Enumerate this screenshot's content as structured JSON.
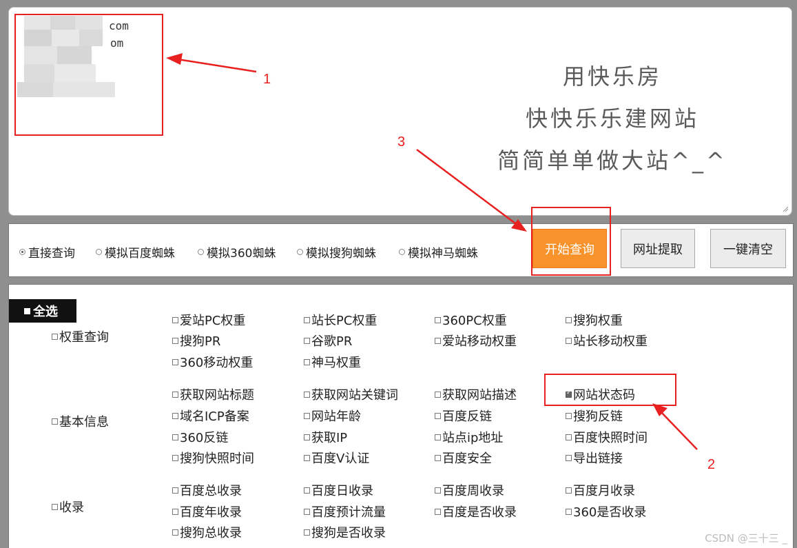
{
  "url_box": {
    "visible_lines": [
      "com",
      "om"
    ],
    "slogan": [
      "用快乐房",
      "快快乐乐建网站",
      "简简单单做大站^_^"
    ]
  },
  "query_modes": [
    {
      "label": "直接查询",
      "selected": true
    },
    {
      "label": "模拟百度蜘蛛",
      "selected": false
    },
    {
      "label": "模拟360蜘蛛",
      "selected": false
    },
    {
      "label": "模拟搜狗蜘蛛",
      "selected": false
    },
    {
      "label": "模拟神马蜘蛛",
      "selected": false
    }
  ],
  "buttons": {
    "start": "开始查询",
    "extract": "网址提取",
    "clear": "一键清空"
  },
  "panel": {
    "select_all": "全选",
    "groups": [
      {
        "label": "权重查询",
        "items": [
          {
            "label": "爱站PC权重",
            "checked": false
          },
          {
            "label": "站长PC权重",
            "checked": false
          },
          {
            "label": "360PC权重",
            "checked": false
          },
          {
            "label": "搜狗权重",
            "checked": false
          },
          {
            "label": "搜狗PR",
            "checked": false
          },
          {
            "label": "谷歌PR",
            "checked": false
          },
          {
            "label": "爱站移动权重",
            "checked": false
          },
          {
            "label": "站长移动权重",
            "checked": false
          },
          {
            "label": "360移动权重",
            "checked": false
          },
          {
            "label": "神马权重",
            "checked": false
          }
        ]
      },
      {
        "label": "基本信息",
        "items": [
          {
            "label": "获取网站标题",
            "checked": false
          },
          {
            "label": "获取网站关键词",
            "checked": false
          },
          {
            "label": "获取网站描述",
            "checked": false
          },
          {
            "label": "网站状态码",
            "checked": true
          },
          {
            "label": "域名ICP备案",
            "checked": false
          },
          {
            "label": "网站年龄",
            "checked": false
          },
          {
            "label": "百度反链",
            "checked": false
          },
          {
            "label": "搜狗反链",
            "checked": false
          },
          {
            "label": "360反链",
            "checked": false
          },
          {
            "label": "获取IP",
            "checked": false
          },
          {
            "label": "站点ip地址",
            "checked": false
          },
          {
            "label": "百度快照时间",
            "checked": false
          },
          {
            "label": "搜狗快照时间",
            "checked": false
          },
          {
            "label": "百度V认证",
            "checked": false
          },
          {
            "label": "百度安全",
            "checked": false
          },
          {
            "label": "导出链接",
            "checked": false
          }
        ]
      },
      {
        "label": "收录",
        "items": [
          {
            "label": "百度总收录",
            "checked": false
          },
          {
            "label": "百度日收录",
            "checked": false
          },
          {
            "label": "百度周收录",
            "checked": false
          },
          {
            "label": "百度月收录",
            "checked": false
          },
          {
            "label": "百度年收录",
            "checked": false
          },
          {
            "label": "百度预计流量",
            "checked": false
          },
          {
            "label": "百度是否收录",
            "checked": false
          },
          {
            "label": "360是否收录",
            "checked": false
          },
          {
            "label": "搜狗总收录",
            "checked": false
          },
          {
            "label": "搜狗是否收录",
            "checked": false
          }
        ]
      }
    ]
  },
  "annotations": [
    "1",
    "2",
    "3"
  ],
  "watermark": "CSDN @三十三 _",
  "colors": {
    "accent": "#f7932a",
    "annotation": "#e82020"
  }
}
